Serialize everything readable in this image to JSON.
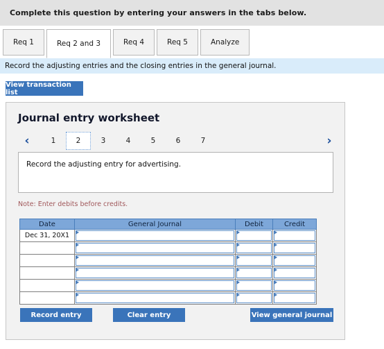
{
  "header": {
    "instruction": "Complete this question by entering your answers in the tabs below."
  },
  "tabs": {
    "items": [
      {
        "label": "Req 1",
        "active": false
      },
      {
        "label": "Req 2 and 3",
        "active": true
      },
      {
        "label": "Req 4",
        "active": false
      },
      {
        "label": "Req 5",
        "active": false
      },
      {
        "label": "Analyze",
        "active": false
      }
    ]
  },
  "requirement_banner": {
    "text": "Record the adjusting entries and the closing entries in the general journal."
  },
  "toolbar": {
    "view_transaction_list_label": "View transaction list"
  },
  "worksheet": {
    "title": "Journal entry worksheet",
    "pager": {
      "prev_icon": "‹",
      "next_icon": "›",
      "pages": [
        "1",
        "2",
        "3",
        "4",
        "5",
        "6",
        "7"
      ],
      "active_page": "2"
    },
    "instruction_text": "Record the adjusting entry for advertising.",
    "note": "Note: Enter debits before credits.",
    "table": {
      "columns": [
        "Date",
        "General Journal",
        "Debit",
        "Credit"
      ],
      "rows": [
        {
          "date": "Dec 31, 20X1",
          "general_journal": "",
          "debit": "",
          "credit": ""
        },
        {
          "date": "",
          "general_journal": "",
          "debit": "",
          "credit": ""
        },
        {
          "date": "",
          "general_journal": "",
          "debit": "",
          "credit": ""
        },
        {
          "date": "",
          "general_journal": "",
          "debit": "",
          "credit": ""
        },
        {
          "date": "",
          "general_journal": "",
          "debit": "",
          "credit": ""
        },
        {
          "date": "",
          "general_journal": "",
          "debit": "",
          "credit": ""
        }
      ]
    },
    "buttons": {
      "record_entry": "Record entry",
      "clear_entry": "Clear entry",
      "view_general_journal": "View general journal"
    }
  },
  "colors": {
    "accent_blue": "#3a74ba",
    "table_header_blue": "#7da7d9",
    "banner_blue": "#d9ecfa",
    "topbar_gray": "#e2e2e2",
    "panel_gray": "#f2f2f2",
    "note_red": "#a0575a"
  }
}
